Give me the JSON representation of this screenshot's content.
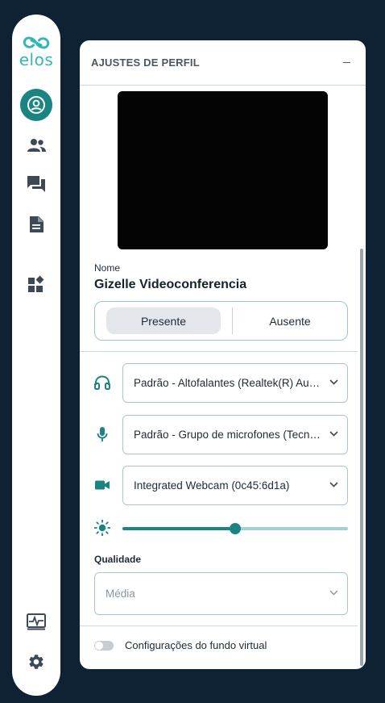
{
  "app": {
    "logo_text": "elos",
    "accent_color": "#1a8482",
    "logo_color": "#35b6b0"
  },
  "sidebar": {
    "items": [
      {
        "name": "profile",
        "icon": "user-circle-icon",
        "active": true
      },
      {
        "name": "participants",
        "icon": "users-icon",
        "active": false
      },
      {
        "name": "chat",
        "icon": "chat-icon",
        "active": false
      },
      {
        "name": "documents",
        "icon": "document-icon",
        "active": false
      },
      {
        "name": "widgets",
        "icon": "widgets-icon",
        "active": false
      },
      {
        "name": "monitor",
        "icon": "monitor-pulse-icon",
        "active": false
      },
      {
        "name": "settings",
        "icon": "gear-icon",
        "active": false
      }
    ]
  },
  "panel": {
    "title": "AJUSTES DE PERFIL",
    "name_label": "Nome",
    "name_value": "Gizelle Videoconferencia",
    "status": {
      "options": [
        "Presente",
        "Ausente"
      ],
      "selected": "Presente"
    },
    "devices": {
      "speaker": "Padrão - Altofalantes (Realtek(R) Audio)",
      "microphone": "Padrão - Grupo de microfones (Tecnologia Intel® Smart Sound para microfones digitais)",
      "camera": "Integrated Webcam (0c45:6d1a)"
    },
    "brightness_fraction": 0.5,
    "quality_label": "Qualidade",
    "quality_value": "Média",
    "virtual_background_label": "Configurações do fundo virtual",
    "virtual_background_enabled": false
  }
}
